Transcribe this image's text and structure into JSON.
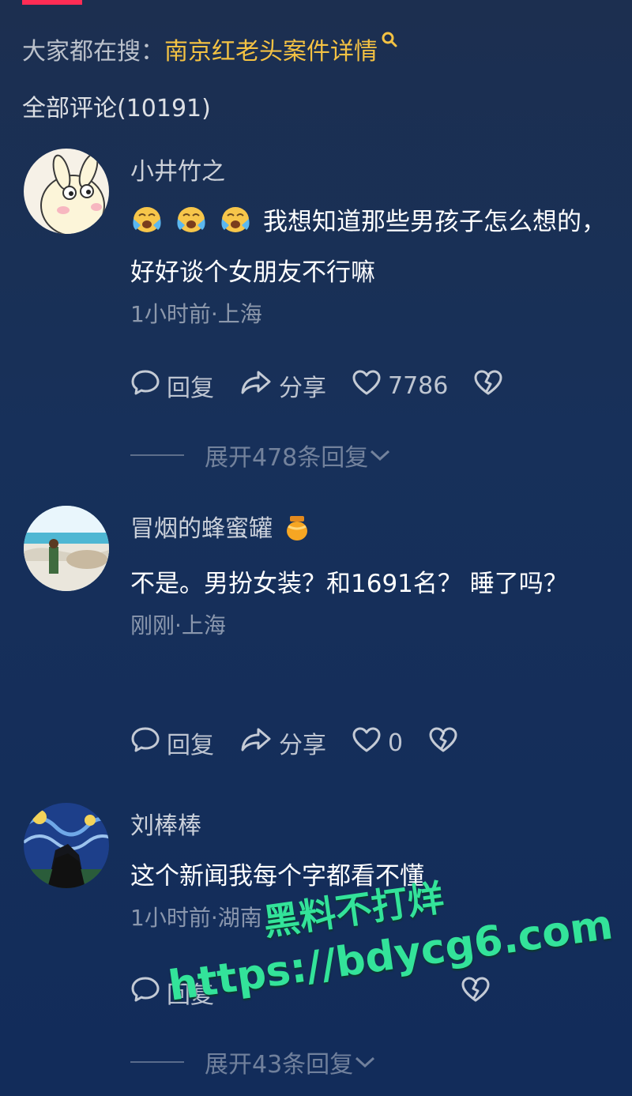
{
  "search": {
    "prefix": "大家都在搜：",
    "keyword": "南京红老头案件详情"
  },
  "comments_header": "全部评论(10191)",
  "comments": [
    {
      "username": "小井竹之",
      "emoji": [
        "loudly-crying-face",
        "loudly-crying-face",
        "loudly-crying-face"
      ],
      "text": "我想知道那些男孩子怎么想的，好好谈个女朋友不行嘛",
      "meta": "1小时前·上海",
      "reply_label": "回复",
      "share_label": "分享",
      "likes": "7786",
      "expand": "展开478条回复"
    },
    {
      "username": "冒烟的蜂蜜罐",
      "username_badge": "honey-pot-icon",
      "text": "不是。男扮女装？和1691名？ 睡了吗？",
      "meta": "刚刚·上海",
      "reply_label": "回复",
      "share_label": "分享",
      "likes": "0"
    },
    {
      "username": "刘棒棒",
      "text": "这个新闻我每个字都看不懂",
      "meta": "1小时前·湖南",
      "reply_label": "回复",
      "expand": "展开43条回复"
    }
  ],
  "watermark": {
    "line1": "黑料不打烊",
    "line2": "https://bdycg6.com"
  },
  "colors": {
    "accent": "#fe2c55",
    "keyword": "#f4c243",
    "watermark": "#33e39a"
  }
}
